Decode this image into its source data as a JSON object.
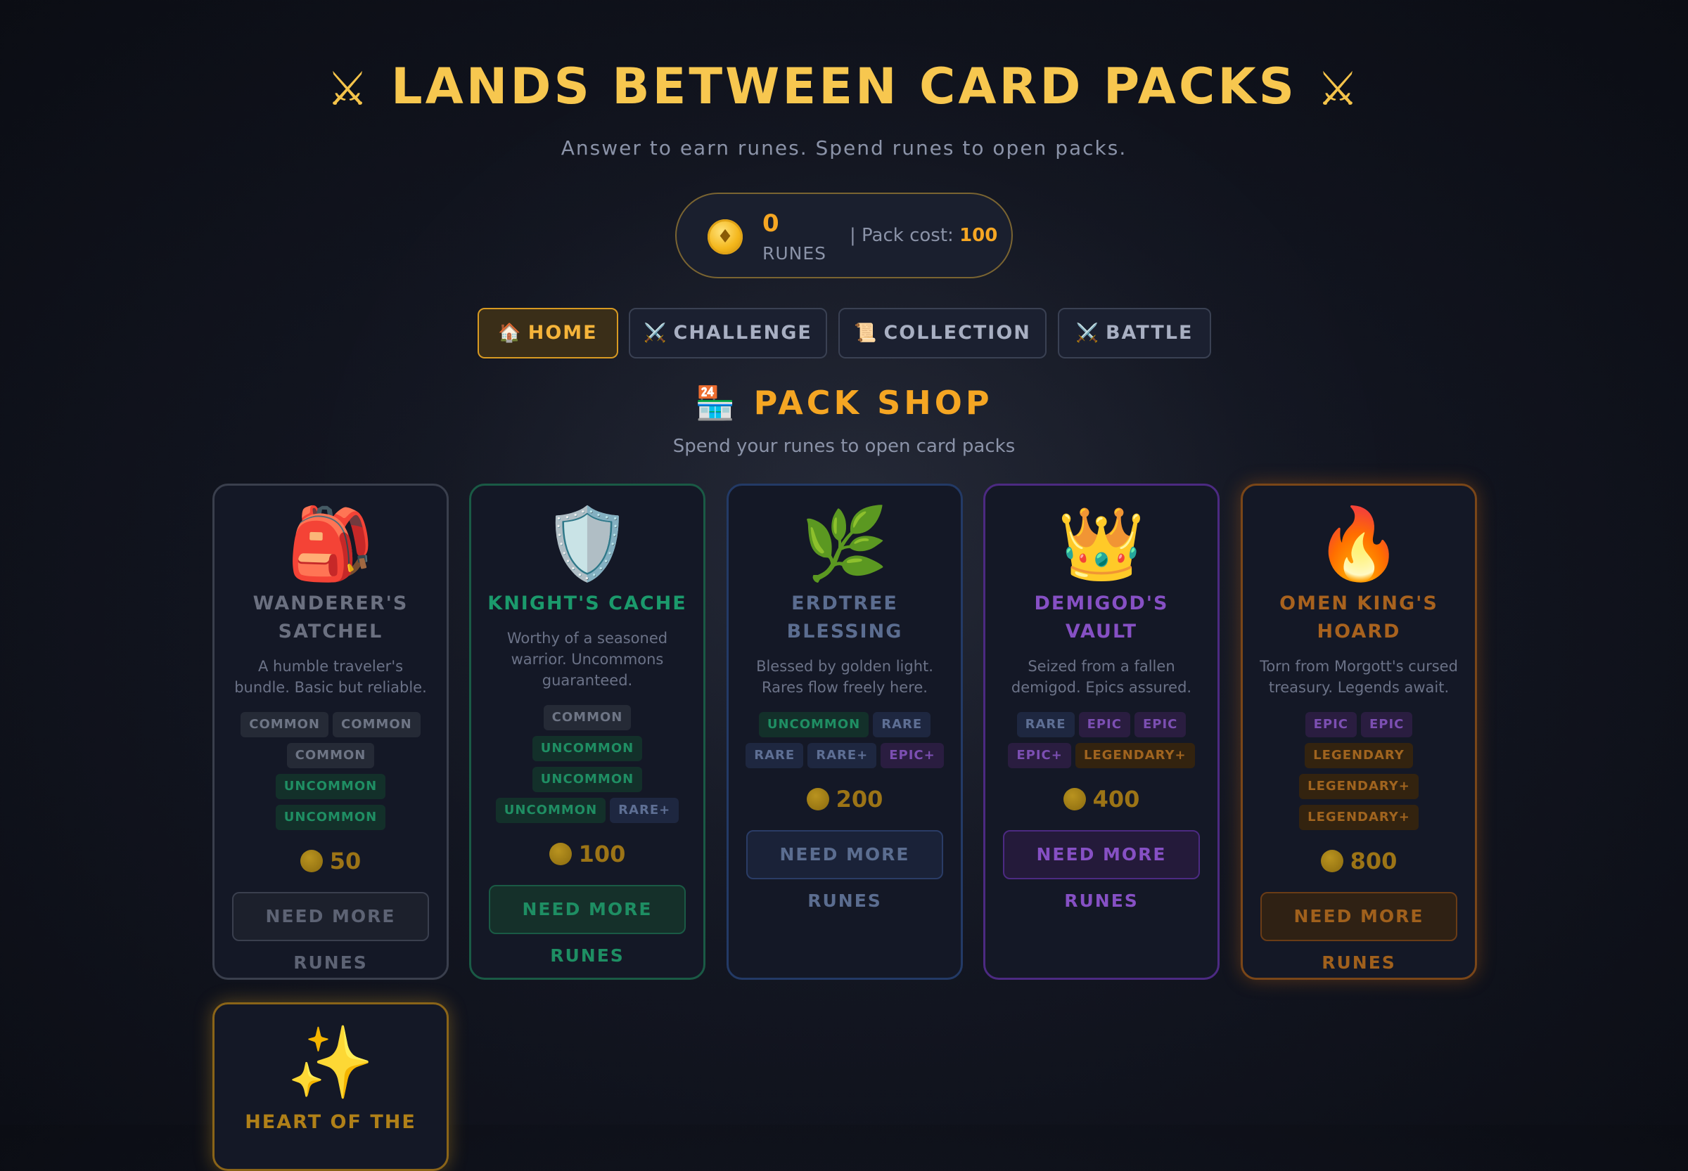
{
  "header": {
    "title": "LANDS BETWEEN CARD PACKS",
    "title_icon": "crossed-swords",
    "subtitle": "Answer to earn runes. Spend runes to open packs."
  },
  "runes": {
    "count": "0",
    "label": "RUNES",
    "pack_cost_label": "| Pack cost: ",
    "pack_cost_value": "100"
  },
  "nav": {
    "tabs": [
      {
        "icon": "🏠",
        "label": "HOME",
        "active": true
      },
      {
        "icon": "⚔️",
        "label": "CHALLENGE",
        "active": false
      },
      {
        "icon": "📜",
        "label": "COLLECTION",
        "active": false
      },
      {
        "icon": "⚔️",
        "label": "BATTLE",
        "active": false
      }
    ]
  },
  "shop": {
    "icon": "🏪",
    "title": "PACK SHOP",
    "subtitle": "Spend your runes to open card packs"
  },
  "packs": [
    {
      "icon": "🎒",
      "name": "WANDERER'S SATCHEL",
      "description": "A humble traveler's bundle. Basic but reliable.",
      "tags": [
        "COMMON",
        "COMMON",
        "COMMON",
        "UNCOMMON",
        "UNCOMMON"
      ],
      "price": "50",
      "button": "NEED MORE RUNES"
    },
    {
      "icon": "🛡️",
      "name": "KNIGHT'S CACHE",
      "description": "Worthy of a seasoned warrior. Uncommons guaranteed.",
      "tags": [
        "COMMON",
        "UNCOMMON",
        "UNCOMMON",
        "UNCOMMON",
        "RARE+"
      ],
      "price": "100",
      "button": "NEED MORE RUNES"
    },
    {
      "icon": "🌿",
      "name": "ERDTREE BLESSING",
      "description": "Blessed by golden light. Rares flow freely here.",
      "tags": [
        "UNCOMMON",
        "RARE",
        "RARE",
        "RARE+",
        "EPIC+"
      ],
      "price": "200",
      "button": "NEED MORE RUNES"
    },
    {
      "icon": "👑",
      "name": "DEMIGOD'S VAULT",
      "description": "Seized from a fallen demigod. Epics assured.",
      "tags": [
        "RARE",
        "EPIC",
        "EPIC",
        "EPIC+",
        "LEGENDARY+"
      ],
      "price": "400",
      "button": "NEED MORE RUNES"
    },
    {
      "icon": "🔥",
      "name": "OMEN KING'S HOARD",
      "description": "Torn from Morgott's cursed treasury. Legends await.",
      "tags": [
        "EPIC",
        "EPIC",
        "LEGENDARY",
        "LEGENDARY+",
        "LEGENDARY+"
      ],
      "price": "800",
      "button": "NEED MORE RUNES"
    },
    {
      "icon": "✨",
      "name": "HEART OF THE"
    }
  ],
  "colors": {
    "gold": "#f7c74f",
    "accent_orange": "#f5a623",
    "uncommon_green": "#1b9a6c",
    "epic_purple": "#8650c4",
    "legendary_orange": "#a8621e"
  }
}
